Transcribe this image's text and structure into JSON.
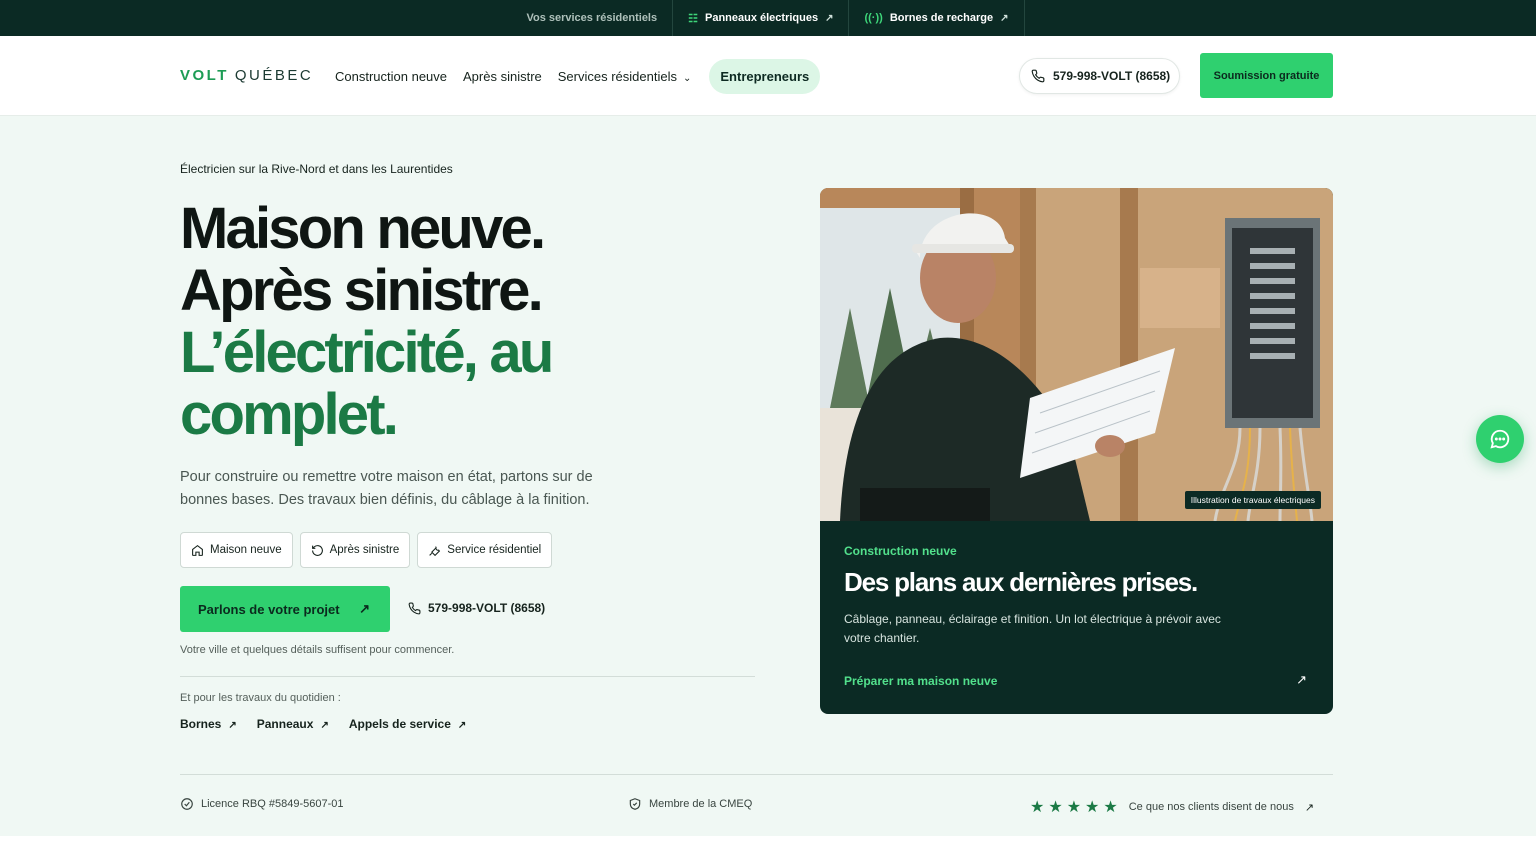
{
  "topbar": {
    "services_label": "Vos services résidentiels",
    "panels_label": "Panneaux électriques",
    "chargers_label": "Bornes de recharge",
    "arrow": "↗"
  },
  "nav": {
    "logo_volt": "VOLT",
    "logo_qc": "QUÉBEC",
    "links": [
      "Construction neuve",
      "Après sinistre",
      "Services résidentiels"
    ],
    "contractors": "Entrepreneurs",
    "phone": "579-998-VOLT (8658)",
    "cta": "Soumission gratuite"
  },
  "hero": {
    "kicker": "Électricien sur la Rive-Nord et dans les Laurentides",
    "headline_1": "Maison neuve.",
    "headline_2": "Après sinistre.",
    "headline_3": "L’électricité, au",
    "headline_4": "complet.",
    "lede": "Pour construire ou remettre votre maison en état, partons sur de bonnes bases. Des travaux bien définis, du câblage à la finition.",
    "chips": [
      "Maison neuve",
      "Après sinistre",
      "Service résidentiel"
    ],
    "cta": "Parlons de votre projet",
    "cta_arrow": "↗",
    "phone": "579-998-VOLT (8658)",
    "cta_note": "Votre ville et quelques détails suffisent pour commencer.",
    "daily_label": "Et pour les travaux du quotidien :",
    "daily_links": [
      "Bornes",
      "Panneaux",
      "Appels de service"
    ]
  },
  "card": {
    "image_tag": "Illustration de travaux électriques",
    "kicker": "Construction neuve",
    "title": "Des plans aux dernières prises.",
    "text": "Câblage, panneau, éclairage et finition. Un lot électrique à prévoir avec votre chantier.",
    "link": "Préparer ma maison neuve",
    "arrow": "↗"
  },
  "trust": {
    "license": "Licence RBQ #5849-5607-01",
    "member": "Membre de la CMEQ",
    "stars": "★★★★★",
    "reviews": "Ce que nos clients disent de nous",
    "arrow": "↗"
  },
  "colors": {
    "topbar_bg": "#0b2a24",
    "accent": "#2fd06f",
    "accent_dark": "#1b7a45",
    "hero_bg": "#f0f8f4"
  }
}
